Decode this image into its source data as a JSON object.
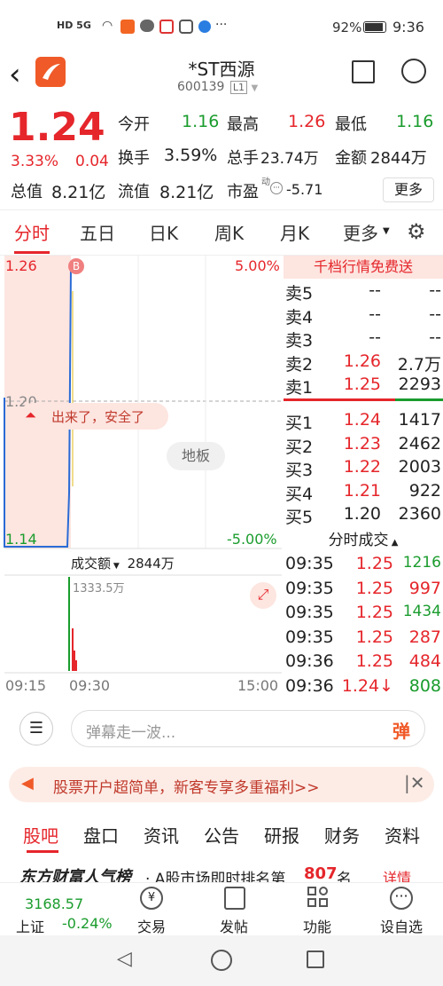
{
  "status": {
    "left_icons": "HD 5G",
    "battery": "92%",
    "time": "9:36"
  },
  "header": {
    "title": "*ST西源",
    "code": "600139",
    "level": "L1"
  },
  "quote": {
    "price": "1.24",
    "pct": "3.33%",
    "change": "0.04",
    "open_label": "今开",
    "open": "1.16",
    "high_label": "最高",
    "high": "1.26",
    "low_label": "最低",
    "low": "1.16",
    "turn_label": "换手",
    "turn": "3.59%",
    "vol_label": "总手",
    "vol": "23.74万",
    "amt_label": "金额",
    "amt": "2844万",
    "cap_label": "总值",
    "cap": "8.21亿",
    "float_label": "流值",
    "float": "8.21亿",
    "pe_label": "市盈",
    "pe_sup": "动",
    "pe": "-5.71",
    "more": "更多"
  },
  "tabs": [
    "分时",
    "五日",
    "日K",
    "周K",
    "月K",
    "更多"
  ],
  "chart": {
    "hi": "1.26",
    "hi_pct": "5.00%",
    "mid": "1.20",
    "lo": "1.14",
    "lo_pct": "-5.00%",
    "badge": "B",
    "bubble": "出来了，安全了",
    "limit": "地板",
    "vol_sel": "成交额",
    "vol_val": "2844万",
    "vol_max": "1333.5万",
    "t0": "09:15",
    "t1": "09:30",
    "t2": "15:00"
  },
  "book": {
    "promo": "千档行情免费送",
    "asks": [
      [
        "卖5",
        "--",
        "--"
      ],
      [
        "卖4",
        "--",
        "--"
      ],
      [
        "卖3",
        "--",
        "--"
      ],
      [
        "卖2",
        "1.26",
        "2.7万"
      ],
      [
        "卖1",
        "1.25",
        "2293"
      ]
    ],
    "bids": [
      [
        "买1",
        "1.24",
        "1417"
      ],
      [
        "买2",
        "1.23",
        "2462"
      ],
      [
        "买3",
        "1.22",
        "2003"
      ],
      [
        "买4",
        "1.21",
        "922"
      ],
      [
        "买5",
        "1.20",
        "2360"
      ]
    ],
    "ticks_title": "分时成交",
    "ticks": [
      [
        "09:35",
        "1.25",
        "1216"
      ],
      [
        "09:35",
        "1.25",
        "997"
      ],
      [
        "09:35",
        "1.25",
        "1434"
      ],
      [
        "09:35",
        "1.25",
        "287"
      ],
      [
        "09:36",
        "1.25",
        "484"
      ],
      [
        "09:36",
        "1.24↓",
        "808"
      ]
    ]
  },
  "danmu": {
    "placeholder": "弹幕走一波...",
    "btn": "弹"
  },
  "promo": {
    "text": "股票开户超简单，新客专享多重福利>>"
  },
  "btabs": [
    "股吧",
    "盘口",
    "资讯",
    "公告",
    "研报",
    "财务",
    "资料"
  ],
  "ticker": {
    "brand": "东方财富人气榜",
    "text": "· A股市场即时排名第",
    "rank": "807",
    "suffix": "名",
    "link": "详情"
  },
  "bottom": {
    "index_val": "3168.57",
    "index_name": "上证",
    "index_pct": "-0.24%",
    "items": [
      "交易",
      "发帖",
      "功能",
      "设自选"
    ]
  }
}
